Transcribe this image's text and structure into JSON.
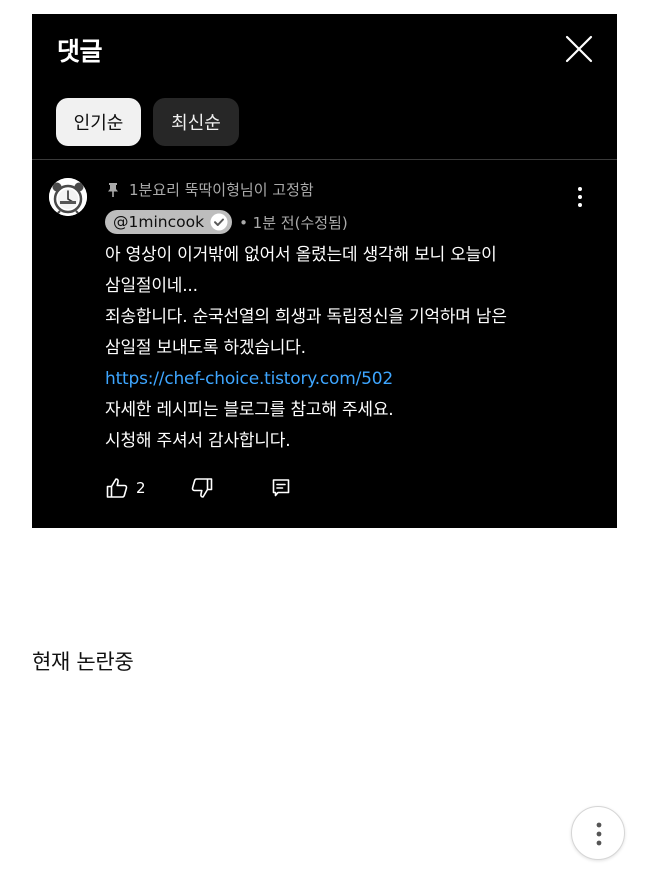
{
  "panel": {
    "title": "댓글",
    "sort_chips": [
      {
        "label": "인기순",
        "selected": true
      },
      {
        "label": "최신순",
        "selected": false
      }
    ]
  },
  "comment": {
    "pinned_label": "1분요리 뚝딱이형님이 고정함",
    "author": "@1mincook",
    "meta": "• 1분 전(수정됨)",
    "lines": [
      "아 영상이 이거밖에 없어서 올렸는데 생각해 보니 오늘이",
      "삼일절이네...",
      "죄송합니다. 순국선열의 희생과 독립정신을 기억하며 남은",
      "삼일절 보내도록 하겠습니다."
    ],
    "link": "https://chef-choice.tistory.com/502",
    "lines_after": [
      "자세한 레시피는 블로그를 참고해 주세요.",
      "시청해 주셔서 감사합니다."
    ],
    "like_count": "2"
  },
  "caption": "현재 논란중",
  "icons": {
    "close": "close-icon",
    "pin": "pin-icon",
    "verified": "verified-check-icon",
    "more": "more-vertical-icon",
    "like": "thumbs-up-icon",
    "dislike": "thumbs-down-icon",
    "reply": "reply-icon"
  },
  "colors": {
    "panel_bg": "#000000",
    "link": "#3ea6ff",
    "meta_text": "#aaaaaa",
    "selected_chip": "#f1f1f1",
    "unselected_chip": "#272727"
  }
}
